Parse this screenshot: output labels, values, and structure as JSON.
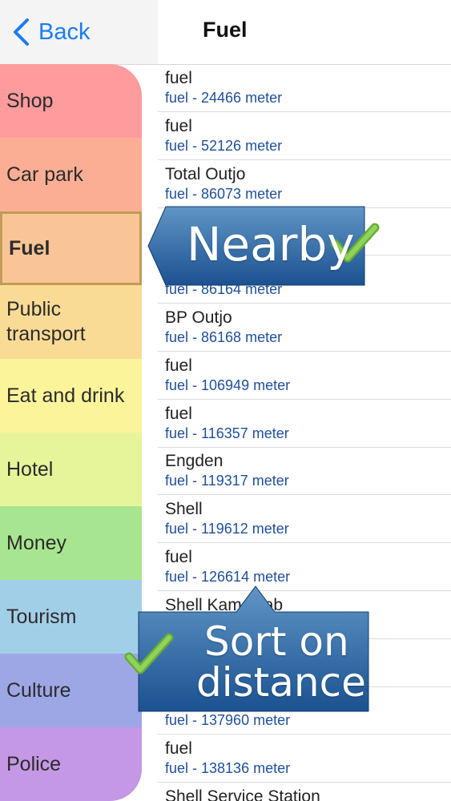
{
  "header": {
    "back_label": "Back",
    "title": "Fuel"
  },
  "sidebar": {
    "items": [
      {
        "label": "Shop",
        "color": "#fd9b9d"
      },
      {
        "label": "Car park",
        "color": "#fcae95"
      },
      {
        "label": "Fuel",
        "color": "#fac596"
      },
      {
        "label": "Public transport",
        "color": "#fadb96"
      },
      {
        "label": "Eat and drink",
        "color": "#fbf49a"
      },
      {
        "label": "Hotel",
        "color": "#e6f59a"
      },
      {
        "label": "Money",
        "color": "#a8e590"
      },
      {
        "label": "Tourism",
        "color": "#a2cfe8"
      },
      {
        "label": "Culture",
        "color": "#9ea7e5"
      },
      {
        "label": "Police",
        "color": "#c498e5"
      }
    ],
    "selected": "Fuel"
  },
  "list": {
    "rows": [
      {
        "name": "fuel",
        "sub": "fuel - 24466 meter"
      },
      {
        "name": "fuel",
        "sub": "fuel - 52126 meter"
      },
      {
        "name": "Total Outjo",
        "sub": "fuel - 86073 meter"
      },
      {
        "name": "",
        "sub": ""
      },
      {
        "name": "",
        "sub": "fuel - 86164 meter"
      },
      {
        "name": "BP Outjo",
        "sub": "fuel - 86168 meter"
      },
      {
        "name": "fuel",
        "sub": "fuel - 106949 meter"
      },
      {
        "name": "fuel",
        "sub": "fuel - 116357 meter"
      },
      {
        "name": "Engden",
        "sub": "fuel - 119317 meter"
      },
      {
        "name": "Shell",
        "sub": "fuel - 119612 meter"
      },
      {
        "name": "fuel",
        "sub": "fuel - 126614 meter"
      },
      {
        "name": "Shell Kamanjab",
        "sub": ""
      },
      {
        "name": "",
        "sub": ""
      },
      {
        "name": "",
        "sub": "fuel - 137960 meter"
      },
      {
        "name": "fuel",
        "sub": "fuel - 138136 meter"
      },
      {
        "name": "Shell Service Station",
        "sub": ""
      }
    ]
  },
  "callouts": {
    "nearby": "Nearby",
    "sort": [
      "Sort on",
      "distance"
    ]
  },
  "colors": {
    "accent": "#1a7cf5",
    "callout_top": "#5c92c2",
    "callout_bottom": "#1a4f8d",
    "check": "#7fc24b"
  }
}
